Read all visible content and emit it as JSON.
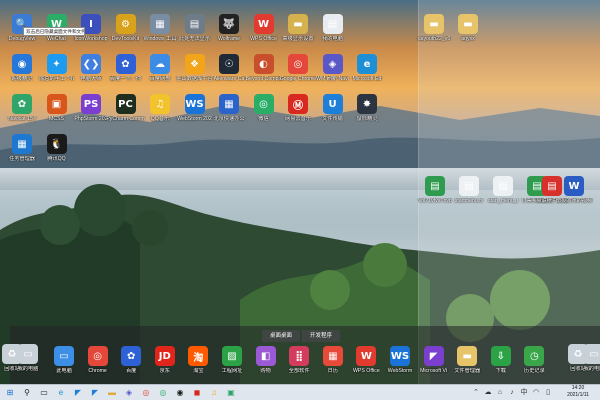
{
  "tooltip": "双击后已隐藏桌面文件和文件夹。",
  "desktop_icons": [
    {
      "label": "DebugView",
      "icon": "magnifier-icon",
      "color": "#3a7bd5",
      "glyph": "🔍"
    },
    {
      "label": "WeChat",
      "icon": "wechat-icon",
      "color": "#2aae67",
      "glyph": "W"
    },
    {
      "label": "IconWorkshop",
      "icon": "icon-workshop-icon",
      "color": "#3b4fbd",
      "glyph": "I"
    },
    {
      "label": "DevToolsKit",
      "icon": "tools-icon",
      "color": "#d9a21b",
      "glyph": "⚙"
    },
    {
      "label": "Windows 工具",
      "icon": "windows-tools-icon",
      "color": "#7a8ea3",
      "glyph": "▦"
    },
    {
      "label": "此处无法显示",
      "icon": "file-icon",
      "color": "#6e7b88",
      "glyph": "▤"
    },
    {
      "label": "Wolframe",
      "icon": "wolf-icon",
      "color": "#222",
      "glyph": "🐺"
    },
    {
      "label": "WPS Office",
      "icon": "wps-icon",
      "color": "#e03b2e",
      "glyph": "W"
    },
    {
      "label": "高级显示设置",
      "icon": "folder-icon",
      "color": "#d6b24f",
      "glyph": "▬"
    },
    {
      "label": "我的电脑",
      "icon": "document-icon",
      "color": "#e8ecf0",
      "glyph": "▤"
    },
    {
      "label": "超级精灵",
      "icon": "app-icon",
      "color": "#2577d9",
      "glyph": "◉"
    },
    {
      "label": "陈总的手工 T-h",
      "icon": "bird-icon",
      "color": "#1d9bf0",
      "glyph": "✦"
    },
    {
      "label": "电脑大师",
      "icon": "code-icon",
      "color": "#3f7fe0",
      "glyph": "❮❯"
    },
    {
      "label": "百度一下，你",
      "icon": "baidu-icon",
      "color": "#2f61d6",
      "glyph": "✿"
    },
    {
      "label": "百度网盘",
      "icon": "cloud-icon",
      "color": "#3c8ce6",
      "glyph": "☁"
    },
    {
      "label": "金山数据库平台",
      "icon": "kingsoft-icon",
      "color": "#f2a51a",
      "glyph": "❖"
    },
    {
      "label": "Alienware Ca",
      "icon": "alien-icon",
      "color": "#1f2a36",
      "glyph": "☉"
    },
    {
      "label": "Beyond Compa",
      "icon": "compare-icon",
      "color": "#c94f2c",
      "glyph": "◐"
    },
    {
      "label": "Google Chrome",
      "icon": "chrome-icon",
      "color": "#e5483a",
      "glyph": "◎"
    },
    {
      "label": "WM 刷新 Navi",
      "icon": "app-icon",
      "color": "#5a57c9",
      "glyph": "◈"
    },
    {
      "label": "Microsoft Ed",
      "icon": "edge-icon",
      "color": "#1c8fd6",
      "glyph": "e"
    },
    {
      "label": "Navicat 15 f",
      "icon": "navicat-icon",
      "color": "#2fa56a",
      "glyph": "✿"
    },
    {
      "label": "MCSS",
      "icon": "css-icon",
      "color": "#d8551b",
      "glyph": "▣"
    },
    {
      "label": "PhpStorm 202",
      "icon": "phpstorm-icon",
      "color": "#7a3fd1",
      "glyph": "PS"
    },
    {
      "label": "PyCharm Comm",
      "icon": "pycharm-icon",
      "color": "#1e2d1e",
      "glyph": "PC"
    },
    {
      "label": "QQ音乐",
      "icon": "music-icon",
      "color": "#f2c32d",
      "glyph": "♫"
    },
    {
      "label": "WebStorm 202",
      "icon": "webstorm-icon",
      "color": "#1a74d8",
      "glyph": "WS"
    },
    {
      "label": "北京快速办公",
      "icon": "office-icon",
      "color": "#2a63c9",
      "glyph": "▦"
    },
    {
      "label": "微信",
      "icon": "wechat-icon",
      "color": "#2aae67",
      "glyph": "◎"
    },
    {
      "label": "网易云音乐",
      "icon": "netease-icon",
      "color": "#d8281f",
      "glyph": "Ⓜ"
    },
    {
      "label": "文件传输",
      "icon": "transfer-icon",
      "color": "#1d7fd7",
      "glyph": "U"
    },
    {
      "label": "鼠标精灵",
      "icon": "mouse-icon",
      "color": "#2b3440",
      "glyph": "✸"
    },
    {
      "label": "任务管理器",
      "icon": "task-manager-icon",
      "color": "#1f78cf",
      "glyph": "▦"
    },
    {
      "label": "腾讯QQ",
      "icon": "qq-icon",
      "color": "#1a1a1a",
      "glyph": "🐧"
    }
  ],
  "right_icons": [
    {
      "label": "dayouth22_v6",
      "icon": "folder-icon",
      "color": "#e7c46a",
      "glyph": "▬"
    },
    {
      "label": "aqyxx",
      "icon": "folder-icon",
      "color": "#e7c46a",
      "glyph": "▬"
    },
    {
      "label": "Vol71vfvvThvb",
      "icon": "spreadsheet-icon",
      "color": "#2e9b4e",
      "glyph": "▤"
    },
    {
      "label": "startmenu.tv",
      "icon": "text-file-icon",
      "color": "#eef1f4",
      "glyph": "▤"
    },
    {
      "label": "start_menu_t",
      "icon": "text-file-icon",
      "color": "#eef1f4",
      "glyph": "▤"
    },
    {
      "label": "订票系统说明",
      "icon": "spreadsheet-icon",
      "color": "#2e9b4e",
      "glyph": "▤"
    },
    {
      "label": "易联帐户文档",
      "icon": "pdf-icon",
      "color": "#d8312b",
      "glyph": "▤"
    },
    {
      "label": "南极的冰的视频",
      "icon": "word-doc-icon",
      "color": "#2a5cc4",
      "glyph": "W"
    }
  ],
  "fence_tabs": [
    "桌面桌面",
    "开发程序"
  ],
  "dock_icons": [
    {
      "label": "此电脑",
      "icon": "monitor-icon",
      "color": "#3d8ee6",
      "glyph": "▭"
    },
    {
      "label": "Chrome",
      "icon": "chrome-icon",
      "color": "#e5483a",
      "glyph": "◎"
    },
    {
      "label": "百度",
      "icon": "baidu-icon",
      "color": "#2f61d6",
      "glyph": "✿"
    },
    {
      "label": "京东",
      "icon": "jd-icon",
      "color": "#e1251b",
      "glyph": "JD"
    },
    {
      "label": "淘宝",
      "icon": "taobao-icon",
      "color": "#ff5a00",
      "glyph": "淘"
    },
    {
      "label": "工程网址",
      "icon": "chart-icon",
      "color": "#2ba245",
      "glyph": "▨"
    },
    {
      "label": "购物",
      "icon": "bag-icon",
      "color": "#9b59d6",
      "glyph": "◧"
    },
    {
      "label": "全部软件",
      "icon": "grid-icon",
      "color": "#d43c5d",
      "glyph": "⣿"
    },
    {
      "label": "日历",
      "icon": "calendar-icon",
      "color": "#e84a3a",
      "glyph": "▦"
    },
    {
      "label": "WPS Office",
      "icon": "wps-icon",
      "color": "#e03b2e",
      "glyph": "W"
    },
    {
      "label": "WebStorm",
      "icon": "webstorm-icon",
      "color": "#1a74d8",
      "glyph": "WS"
    },
    {
      "label": "Microsoft Vi",
      "icon": "vs-icon",
      "color": "#7b3fcf",
      "glyph": "◤"
    },
    {
      "label": "文件管理器",
      "icon": "folder-icon",
      "color": "#e7c46a",
      "glyph": "▬"
    },
    {
      "label": "下载",
      "icon": "download-icon",
      "color": "#2ba245",
      "glyph": "⇩"
    },
    {
      "label": "历史记录",
      "icon": "clock-icon",
      "color": "#3aa64a",
      "glyph": "◷"
    }
  ],
  "dock_side_icons": [
    {
      "label": "回收站",
      "icon": "recycle-bin-icon",
      "color": "#c8d0d8",
      "glyph": "♻"
    },
    {
      "label": "我的电脑",
      "icon": "computer-icon",
      "color": "#c8d0d8",
      "glyph": "▭"
    }
  ],
  "taskbar": {
    "items": [
      {
        "icon": "windows-start-icon",
        "glyph": "⊞",
        "color": "#1c6fd1"
      },
      {
        "icon": "search-icon",
        "glyph": "⚲",
        "color": "#222"
      },
      {
        "icon": "task-view-icon",
        "glyph": "▭",
        "color": "#222"
      },
      {
        "icon": "edge-icon",
        "glyph": "e",
        "color": "#1c8fd6"
      },
      {
        "icon": "vscode-icon",
        "glyph": "◤",
        "color": "#1f7fd6"
      },
      {
        "icon": "vscode-icon",
        "glyph": "◤",
        "color": "#1f7fd6"
      },
      {
        "icon": "file-explorer-icon",
        "glyph": "▬",
        "color": "#e2a93b"
      },
      {
        "icon": "app-icon",
        "glyph": "◈",
        "color": "#5a57c9"
      },
      {
        "icon": "chrome-icon",
        "glyph": "◎",
        "color": "#e5483a"
      },
      {
        "icon": "wechat-icon",
        "glyph": "◎",
        "color": "#2aae67"
      },
      {
        "icon": "qq-icon",
        "glyph": "◉",
        "color": "#1a1a1a"
      },
      {
        "icon": "app-icon",
        "glyph": "◼",
        "color": "#d8281f"
      },
      {
        "icon": "music-icon",
        "glyph": "♫",
        "color": "#f2a51a"
      },
      {
        "icon": "pycharm-icon",
        "glyph": "▣",
        "color": "#2fa56a"
      }
    ],
    "tray": [
      {
        "icon": "chevron-up-icon",
        "glyph": "⌃"
      },
      {
        "icon": "cloud-icon",
        "glyph": "☁"
      },
      {
        "icon": "network-icon",
        "glyph": "⌂"
      },
      {
        "icon": "volume-icon",
        "glyph": "♪"
      },
      {
        "icon": "input-method-icon",
        "glyph": "中"
      },
      {
        "icon": "wifi-icon",
        "glyph": "◠"
      },
      {
        "icon": "battery-icon",
        "glyph": "▯"
      }
    ],
    "time": "14:20",
    "date": "2021/1/11"
  }
}
